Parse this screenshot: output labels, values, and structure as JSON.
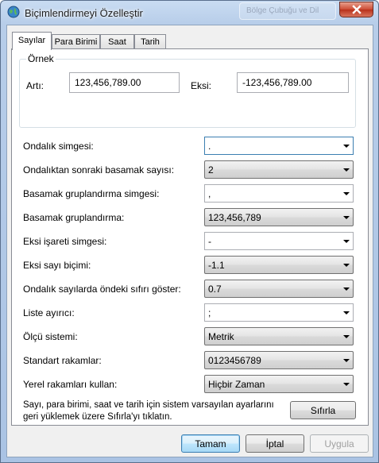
{
  "window": {
    "title": "Biçimlendirmeyi Özelleştir",
    "background_tab_text": "Bölge Çubuğu ve Dil",
    "accent_color": "#3c7fb1"
  },
  "tabs": [
    {
      "label": "Sayılar",
      "active": true
    },
    {
      "label": "Para Birimi",
      "active": false
    },
    {
      "label": "Saat",
      "active": false
    },
    {
      "label": "Tarih",
      "active": false
    }
  ],
  "sample": {
    "group_title": "Örnek",
    "positive_label": "Artı:",
    "positive_value": "123,456,789.00",
    "negative_label": "Eksi:",
    "negative_value": "-123,456,789.00"
  },
  "settings": [
    {
      "label": "Ondalık simgesi:",
      "value": ".",
      "editable": true
    },
    {
      "label": "Ondalıktan sonraki basamak sayısı:",
      "value": "2",
      "editable": false
    },
    {
      "label": "Basamak gruplandırma simgesi:",
      "value": ",",
      "editable": true
    },
    {
      "label": "Basamak gruplandırma:",
      "value": "123,456,789",
      "editable": false
    },
    {
      "label": "Eksi işareti simgesi:",
      "value": "-",
      "editable": true
    },
    {
      "label": "Eksi sayı biçimi:",
      "value": "-1.1",
      "editable": false
    },
    {
      "label": "Ondalık sayılarda öndeki sıfırı göster:",
      "value": "0.7",
      "editable": false
    },
    {
      "label": "Liste ayırıcı:",
      "value": ";",
      "editable": true
    },
    {
      "label": "Ölçü sistemi:",
      "value": "Metrik",
      "editable": false
    },
    {
      "label": "Standart rakamlar:",
      "value": "0123456789",
      "editable": false
    },
    {
      "label": "Yerel rakamları kullan:",
      "value": "Hiçbir Zaman",
      "editable": false
    }
  ],
  "reset": {
    "text": "Sayı, para birimi, saat ve tarih için sistem varsayılan ayarlarını geri yüklemek üzere Sıfırla'yı tıklatın.",
    "button_label": "Sıfırla"
  },
  "footer": {
    "ok_label": "Tamam",
    "cancel_label": "İptal",
    "apply_label": "Uygula"
  }
}
